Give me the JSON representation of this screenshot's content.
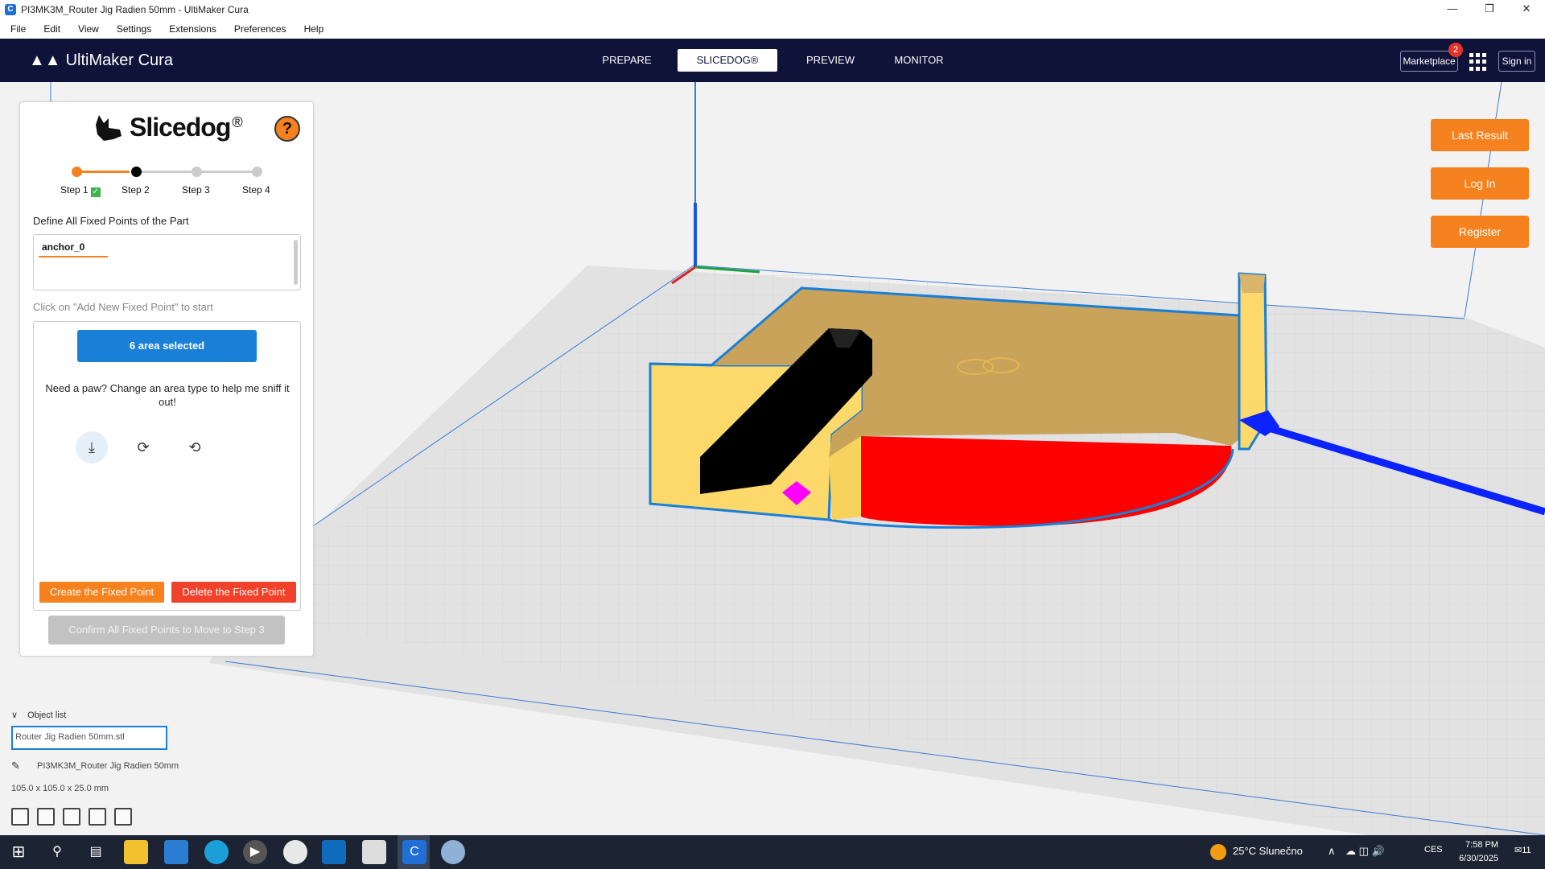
{
  "window": {
    "title": "PI3MK3M_Router Jig Radien 50mm - UltiMaker Cura",
    "controls": [
      "minimize-icon",
      "restore-icon",
      "close-icon"
    ]
  },
  "menu": [
    "File",
    "Edit",
    "View",
    "Settings",
    "Extensions",
    "Preferences",
    "Help"
  ],
  "header": {
    "logo": "UltiMaker Cura",
    "stages": [
      {
        "label": "PREPARE",
        "active": false
      },
      {
        "label": "SLICEDOG®",
        "active": true
      },
      {
        "label": "PREVIEW",
        "active": false
      },
      {
        "label": "MONITOR",
        "active": false
      }
    ],
    "marketplace": "Marketplace",
    "marketplace_badge": "2",
    "sign_in": "Sign in"
  },
  "slicedog": {
    "brand": "Slicedog",
    "reg": "®",
    "help": "?",
    "steps": [
      {
        "label": "Step 1",
        "done": true
      },
      {
        "label": "Step 2",
        "current": true
      },
      {
        "label": "Step 3"
      },
      {
        "label": "Step 4"
      }
    ],
    "section_title": "Define All Fixed Points of the Part",
    "anchor": "anchor_0",
    "hint": "Click on \"Add New Fixed Point\" to start",
    "area_selected": "6 area selected",
    "paw_text": "Need a paw? Change an area type to help me sniff it out!",
    "tools": [
      "download-icon",
      "rotate-icon",
      "rotate-alt-icon"
    ],
    "create_label": "Create the Fixed Point",
    "delete_label": "Delete the Fixed Point",
    "confirm_label": "Confirm All Fixed Points to Move to Step 3"
  },
  "right_buttons": [
    "Last Result",
    "Log In",
    "Register"
  ],
  "object_list": {
    "heading": "Object list",
    "file": "Router Jig Radien 50mm.stl",
    "object_name": "PI3MK3M_Router Jig Radien 50mm",
    "dimensions": "105.0 x 105.0 x 25.0 mm"
  },
  "taskbar": {
    "weather": "25°C  Slunečno",
    "lang": "CES",
    "time": "7:58 PM",
    "date": "6/30/2025",
    "notifications": "11"
  },
  "colors": {
    "header_bg": "#0f1239",
    "accent_orange": "#f5821f",
    "accent_blue": "#1a7fd6",
    "delete_red": "#f0412a",
    "model_top": "#c9a35a",
    "model_side": "#fcd96a",
    "model_selected": "#ff0000"
  }
}
